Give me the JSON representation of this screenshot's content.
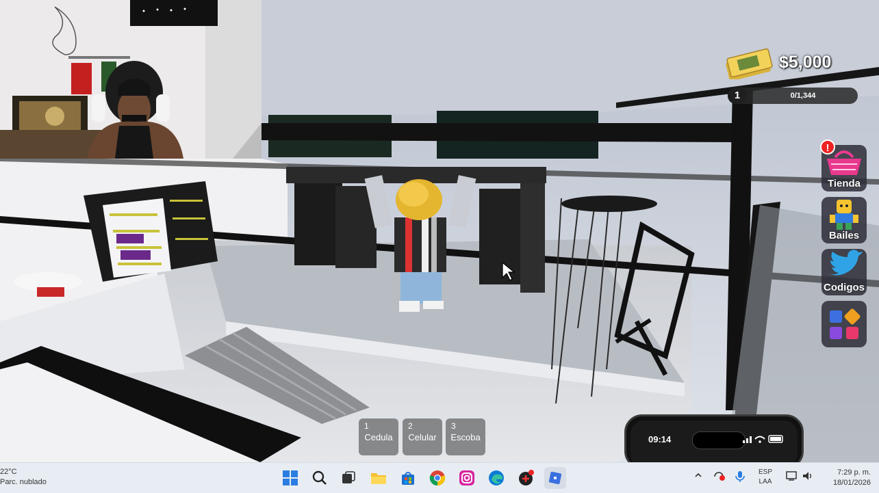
{
  "hud": {
    "money": "$5,000",
    "level": "1",
    "xp_progress": "0/1,344",
    "xp_fraction": 0
  },
  "side_menu": {
    "shop_label": "Tienda",
    "dances_label": "Bailes",
    "codes_label": "Codigos",
    "alert_symbol": "!"
  },
  "hotbar": [
    {
      "num": "1",
      "name": "Cedula"
    },
    {
      "num": "2",
      "name": "Celular"
    },
    {
      "num": "3",
      "name": "Escoba"
    }
  ],
  "phone": {
    "time": "09:14"
  },
  "taskbar": {
    "temperature": "22°C",
    "weather_desc": "Parc. nublado",
    "lang_line1": "ESP",
    "lang_line2": "LAA",
    "time": "7:29 p. m.",
    "date": "18/01/2026",
    "icons": [
      "windows-start-icon",
      "search-icon",
      "task-view-icon",
      "file-explorer-icon",
      "store-icon",
      "chrome-icon",
      "instagram-icon",
      "edge-icon",
      "game-app-icon",
      "roblox-icon"
    ]
  },
  "colors": {
    "accent_money": "#f3d25a",
    "shop_pink": "#e8398f",
    "codes_blue": "#2fa3e6"
  }
}
